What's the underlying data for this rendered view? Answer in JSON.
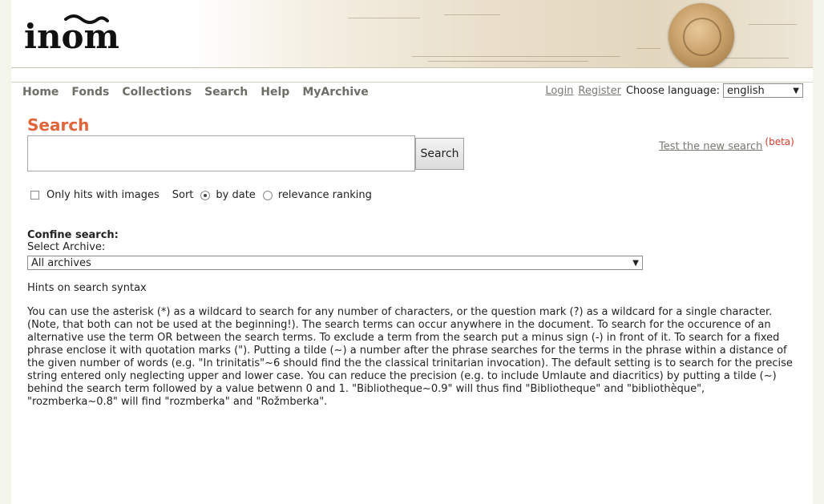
{
  "banner": {
    "logo_text": "inom",
    "colors": {
      "page_bg": "#f4f5ea",
      "accent": "#e0653a",
      "link": "#7a7a72"
    }
  },
  "nav": [
    "Home",
    "Fonds",
    "Collections",
    "Search",
    "Help",
    "MyArchive"
  ],
  "account": {
    "login": "Login",
    "register": "Register",
    "language_label": "Choose language:",
    "language_value": "english"
  },
  "search": {
    "title": "Search",
    "input_value": "",
    "button_label": "Search",
    "new_search_link": "Test the new search",
    "beta_label": "(beta)"
  },
  "options": {
    "images_only_label": "Only hits with images",
    "images_only_checked": false,
    "sort_label": "Sort",
    "sort_date_label": "by date",
    "sort_relevance_label": "relevance ranking",
    "sort_selected": "by date"
  },
  "confine": {
    "heading": "Confine search:",
    "archive_label": "Select Archive:",
    "archive_value": "All archives"
  },
  "hints": {
    "title": "Hints on search syntax",
    "text": "You can use the asterisk (*) as a wildcard to search for any number of characters, or the question mark (?) as a wildcard for a single character. (Note, that both can not be used at the beginning!). The search terms can occur anywhere in the document. To search for the occurence of an alternative use the term OR between the search terms. To exclude a term from the search put a minus sign (-) in front of it. To search for a fixed phrase enclose it with quotation marks (\"). Putting a tilde (~) a number after the phrase searches for the terms in the phrase within a distance of the given number of words (e.g. \"In trinitatis\"~6 should find the the classical trinitarian invocation). The default setting is to search for the precise string entered only neglecting upper and lower case. You can reduce the precision (e.g. to include Umlaute and diacritics) by putting a tilde (~) behind the search term followed by a value betwenn 0 and 1. \"Bibliotheque~0.9\" will thus find \"Bibliotheque\" and \"bibliothèque\", \"rozmberka~0.8\" will find \"rozmberka\" and \"Rožmberka\"."
  },
  "icons": [
    "seal-image",
    "dropdown-arrow-icon"
  ]
}
